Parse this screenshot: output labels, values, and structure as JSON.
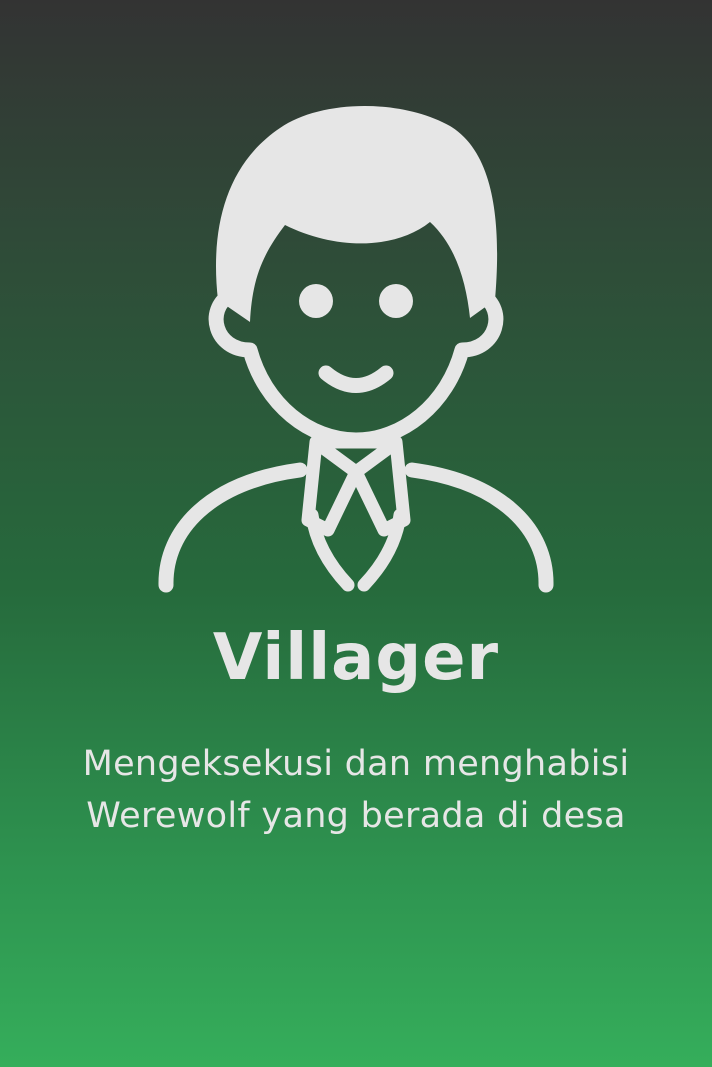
{
  "card": {
    "icon": "villager-icon",
    "role_name": "Villager",
    "description_lines": [
      "Mengeksekusi dan menghabisi",
      "Werewolf yang berada di desa"
    ]
  },
  "colors": {
    "background_top": "#333333",
    "background_bottom": "#35ae5b",
    "foreground": "#e6e6e6"
  }
}
